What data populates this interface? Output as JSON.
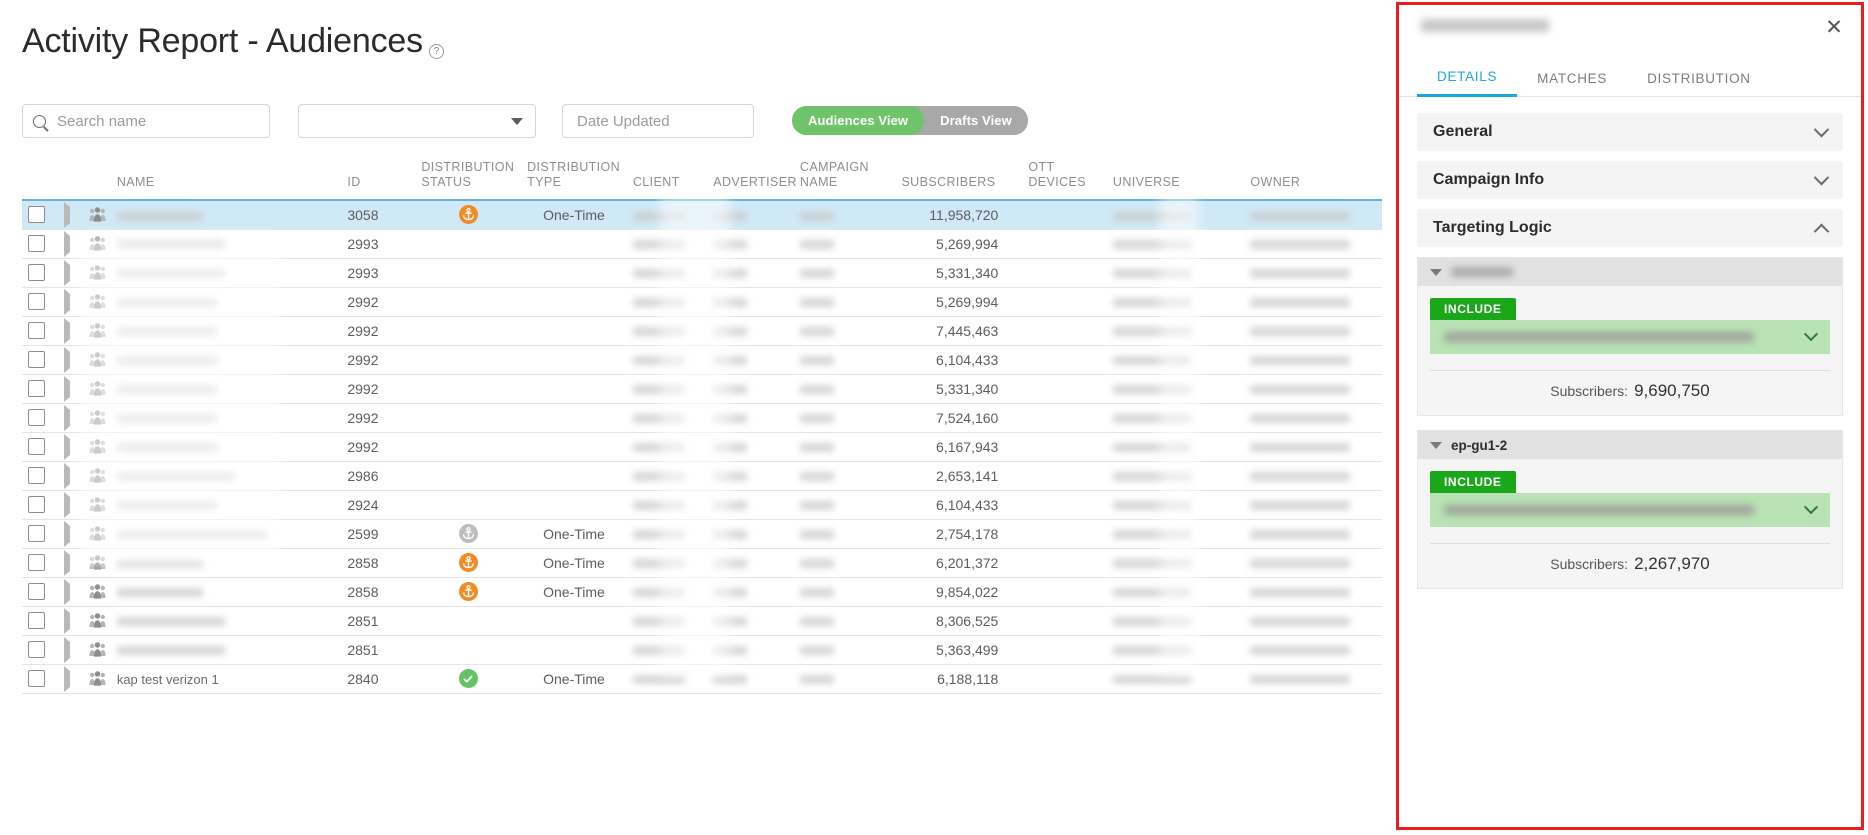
{
  "page": {
    "title": "Activity Report - Audiences",
    "help_icon": "question-mark-icon"
  },
  "toolbar": {
    "search_placeholder": "Search name",
    "search_value": "",
    "search_icon": "search-icon",
    "filter_select_value": "",
    "filter_select_icon": "chevron-down-icon",
    "date_placeholder": "Date Updated",
    "date_value": "",
    "view_toggle": {
      "active_label": "Audiences View",
      "inactive_label": "Drafts View",
      "active_color": "#6fc368",
      "inactive_color": "#a8a8a8"
    }
  },
  "table": {
    "columns": [
      "NAME",
      "ID",
      "DISTRIBUTION STATUS",
      "DISTRIBUTION TYPE",
      "CLIENT",
      "ADVERTISER",
      "CAMPAIGN NAME",
      "SUBSCRIBERS",
      "OTT DEVICES",
      "UNIVERSE",
      "OWNER"
    ],
    "header_underline_color": "#67b3d6",
    "selected_row_color": "#cfe9f7",
    "rows": [
      {
        "selected": true,
        "name": "",
        "id": "3058",
        "dist_status": "orange-anchor-icon",
        "dist_type": "One-Time",
        "client": "",
        "advertiser": "",
        "campaign": "",
        "subscribers": "11,958,720",
        "ott": "",
        "universe": "",
        "owner": ""
      },
      {
        "selected": false,
        "name": "",
        "id": "2993",
        "dist_status": "",
        "dist_type": "",
        "client": "",
        "advertiser": "",
        "campaign": "",
        "subscribers": "5,269,994",
        "ott": "",
        "universe": "",
        "owner": ""
      },
      {
        "selected": false,
        "name": "",
        "id": "2993",
        "dist_status": "",
        "dist_type": "",
        "client": "",
        "advertiser": "",
        "campaign": "",
        "subscribers": "5,331,340",
        "ott": "",
        "universe": "",
        "owner": ""
      },
      {
        "selected": false,
        "name": "",
        "id": "2992",
        "dist_status": "",
        "dist_type": "",
        "client": "",
        "advertiser": "",
        "campaign": "",
        "subscribers": "5,269,994",
        "ott": "",
        "universe": "",
        "owner": ""
      },
      {
        "selected": false,
        "name": "",
        "id": "2992",
        "dist_status": "",
        "dist_type": "",
        "client": "",
        "advertiser": "",
        "campaign": "",
        "subscribers": "7,445,463",
        "ott": "",
        "universe": "",
        "owner": ""
      },
      {
        "selected": false,
        "name": "",
        "id": "2992",
        "dist_status": "",
        "dist_type": "",
        "client": "",
        "advertiser": "",
        "campaign": "",
        "subscribers": "6,104,433",
        "ott": "",
        "universe": "",
        "owner": ""
      },
      {
        "selected": false,
        "name": "",
        "id": "2992",
        "dist_status": "",
        "dist_type": "",
        "client": "",
        "advertiser": "",
        "campaign": "",
        "subscribers": "5,331,340",
        "ott": "",
        "universe": "",
        "owner": ""
      },
      {
        "selected": false,
        "name": "",
        "id": "2992",
        "dist_status": "",
        "dist_type": "",
        "client": "",
        "advertiser": "",
        "campaign": "",
        "subscribers": "7,524,160",
        "ott": "",
        "universe": "",
        "owner": ""
      },
      {
        "selected": false,
        "name": "",
        "id": "2992",
        "dist_status": "",
        "dist_type": "",
        "client": "",
        "advertiser": "",
        "campaign": "",
        "subscribers": "6,167,943",
        "ott": "",
        "universe": "",
        "owner": ""
      },
      {
        "selected": false,
        "name": "",
        "id": "2986",
        "dist_status": "",
        "dist_type": "",
        "client": "",
        "advertiser": "",
        "campaign": "",
        "subscribers": "2,653,141",
        "ott": "",
        "universe": "",
        "owner": ""
      },
      {
        "selected": false,
        "name": "",
        "id": "2924",
        "dist_status": "",
        "dist_type": "",
        "client": "",
        "advertiser": "",
        "campaign": "",
        "subscribers": "6,104,433",
        "ott": "",
        "universe": "",
        "owner": ""
      },
      {
        "selected": false,
        "name": "",
        "id": "2599",
        "dist_status": "gray-anchor-icon",
        "dist_type": "One-Time",
        "client": "",
        "advertiser": "",
        "campaign": "",
        "subscribers": "2,754,178",
        "ott": "",
        "universe": "",
        "owner": ""
      },
      {
        "selected": false,
        "name": "",
        "id": "2858",
        "dist_status": "orange-anchor-icon",
        "dist_type": "One-Time",
        "client": "",
        "advertiser": "",
        "campaign": "",
        "subscribers": "6,201,372",
        "ott": "",
        "universe": "",
        "owner": ""
      },
      {
        "selected": false,
        "name": "",
        "id": "2858",
        "dist_status": "orange-anchor-icon",
        "dist_type": "One-Time",
        "client": "",
        "advertiser": "",
        "campaign": "",
        "subscribers": "9,854,022",
        "ott": "",
        "universe": "",
        "owner": ""
      },
      {
        "selected": false,
        "name": "",
        "id": "2851",
        "dist_status": "",
        "dist_type": "",
        "client": "",
        "advertiser": "",
        "campaign": "",
        "subscribers": "8,306,525",
        "ott": "",
        "universe": "",
        "owner": ""
      },
      {
        "selected": false,
        "name": "",
        "id": "2851",
        "dist_status": "",
        "dist_type": "",
        "client": "",
        "advertiser": "",
        "campaign": "",
        "subscribers": "5,363,499",
        "ott": "",
        "universe": "",
        "owner": ""
      },
      {
        "selected": false,
        "name": "kap test verizon 1",
        "id": "2840",
        "dist_status": "green-check-icon",
        "dist_type": "One-Time",
        "client": "",
        "advertiser": "",
        "campaign": "",
        "subscribers": "6,188,118",
        "ott": "",
        "universe": "",
        "owner": ""
      }
    ]
  },
  "panel": {
    "border_color": "#ee1c1c",
    "title": "",
    "close_icon": "close-icon",
    "tabs": [
      {
        "label": "DETAILS",
        "active": true
      },
      {
        "label": "MATCHES",
        "active": false
      },
      {
        "label": "DISTRIBUTION",
        "active": false
      }
    ],
    "active_tab_color": "#19a8e0",
    "accordions": [
      {
        "label": "General",
        "expanded": false,
        "icon": "chevron-down-icon"
      },
      {
        "label": "Campaign Info",
        "expanded": false,
        "icon": "chevron-down-icon"
      },
      {
        "label": "Targeting Logic",
        "expanded": true,
        "icon": "chevron-up-icon"
      }
    ],
    "targeting_logic": {
      "groups": [
        {
          "name": "",
          "name_blurred": true,
          "operator_badge": "INCLUDE",
          "badge_color": "#1aa81a",
          "rule_text": "",
          "rule_chip_color": "#b9e3b4",
          "subscribers_label": "Subscribers:",
          "subscribers_value": "9,690,750"
        },
        {
          "name": "ep-gu1-2",
          "name_blurred": false,
          "operator_badge": "INCLUDE",
          "badge_color": "#1aa81a",
          "rule_text": "",
          "rule_chip_color": "#b9e3b4",
          "subscribers_label": "Subscribers:",
          "subscribers_value": "2,267,970"
        }
      ]
    }
  }
}
